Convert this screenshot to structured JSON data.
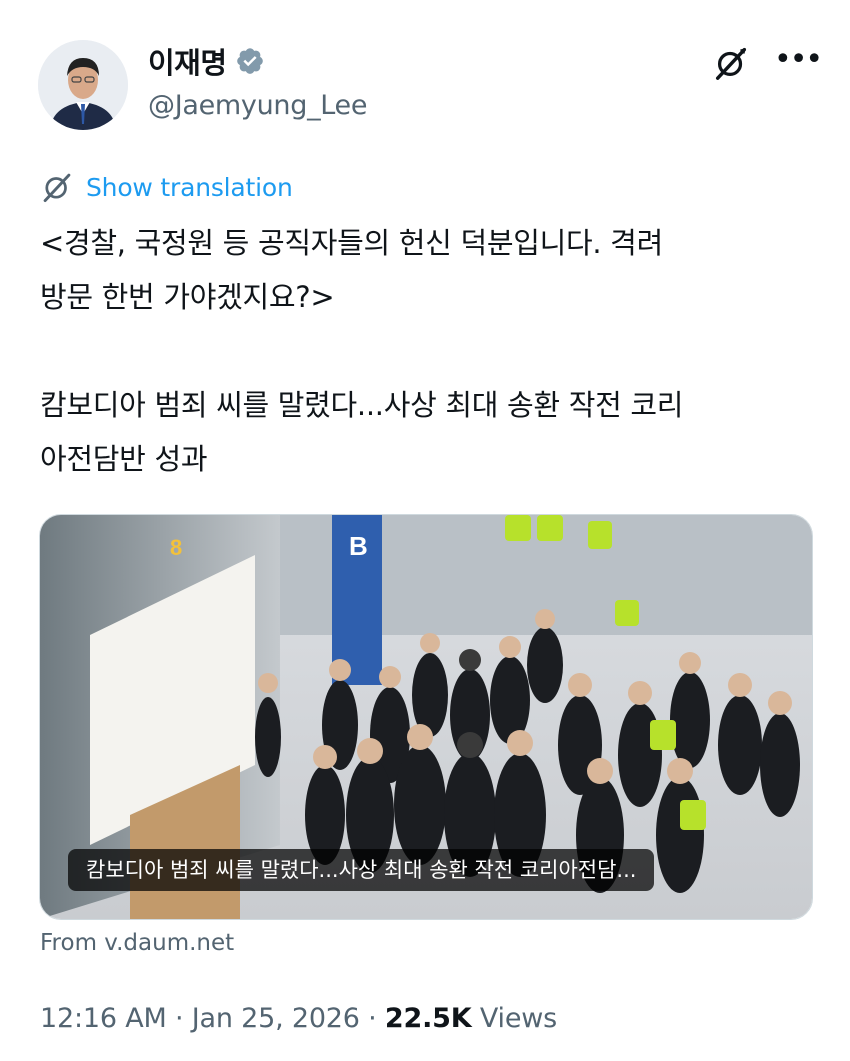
{
  "author": {
    "name": "이재명",
    "handle": "@Jaemyung_Lee",
    "verified_color": "#829aab",
    "avatar": "profile-photo"
  },
  "header_actions": {
    "grok_icon": "grok-icon",
    "more_icon": "more-icon",
    "more_glyph": "•••"
  },
  "translate": {
    "icon": "grok-icon",
    "label": "Show translation"
  },
  "tweet": {
    "line1": "<경찰, 국정원 등 공직자들의 헌신 덕분입니다. 격려",
    "line2": "방문 한번 가야겠지요?>",
    "line3": "캄보디아 범죄 씨를 말렸다...사상 최대 송환 작전 코리",
    "line4": "아전담반 성과"
  },
  "link_card": {
    "caption": "캄보디아 범죄 씨를 말렸다...사상 최대 송환 작전 코리아전담...",
    "source": "From v.daum.net",
    "sign_letter": "B",
    "sign_number": "8"
  },
  "meta": {
    "time": "12:16 AM",
    "sep1": " · ",
    "date": "Jan 25, 2026",
    "sep2": " · ",
    "views_count": "22.5K",
    "views_label": " Views"
  },
  "colors": {
    "link": "#1d9bf0",
    "secondary_text": "#536471",
    "primary_text": "#0f1419"
  }
}
